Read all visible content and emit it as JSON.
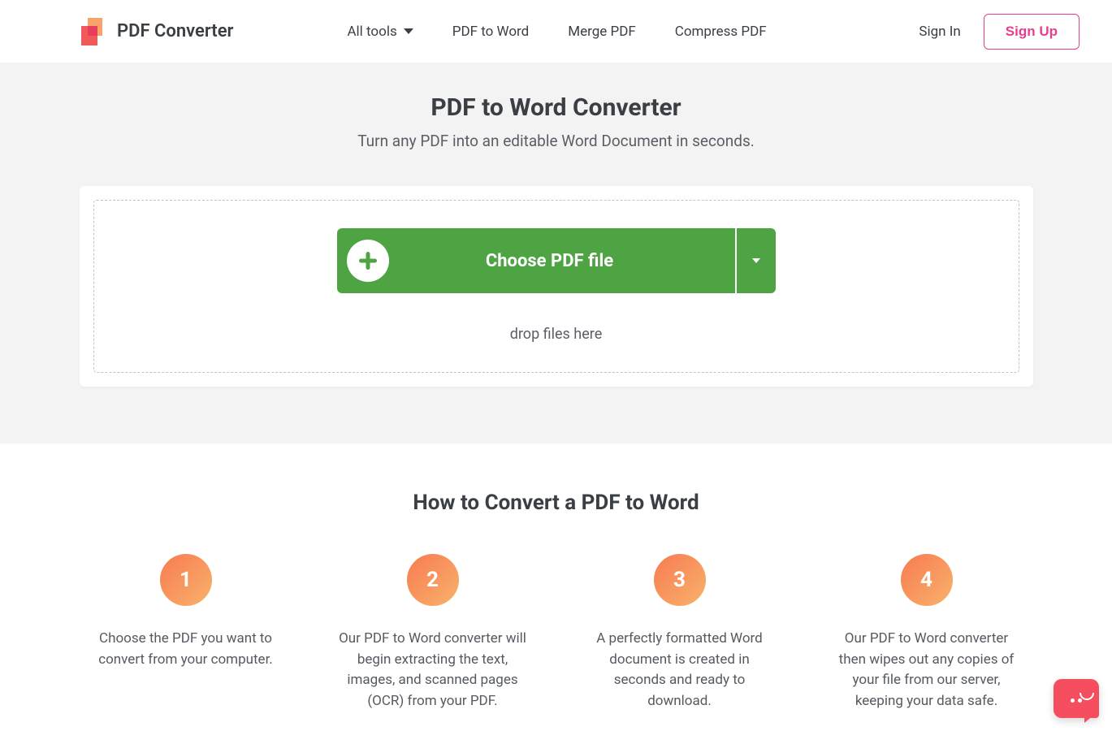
{
  "brand": {
    "name": "PDF Converter"
  },
  "nav": {
    "all_tools": "All tools",
    "pdf_to_word": "PDF to Word",
    "merge_pdf": "Merge PDF",
    "compress_pdf": "Compress PDF"
  },
  "auth": {
    "sign_in": "Sign In",
    "sign_up": "Sign Up"
  },
  "hero": {
    "title": "PDF to Word Converter",
    "subtitle": "Turn any PDF into an editable Word Document in seconds.",
    "choose_label": "Choose PDF file",
    "drop_text": "drop files here"
  },
  "howto": {
    "title": "How to Convert a PDF to Word",
    "steps": [
      {
        "num": "1",
        "text": "Choose the PDF you want to convert from your computer."
      },
      {
        "num": "2",
        "text": "Our PDF to Word converter will begin extracting the text, images, and scanned pages (OCR) from your PDF."
      },
      {
        "num": "3",
        "text": "A perfectly formatted Word document is created in seconds and ready to download."
      },
      {
        "num": "4",
        "text": "Our PDF to Word converter then wipes out any copies of your file from our server, keeping your data safe."
      }
    ]
  },
  "colors": {
    "accent_pink": "#e83e8c",
    "accent_green": "#4ea342",
    "chat_red": "#f44e5f"
  }
}
